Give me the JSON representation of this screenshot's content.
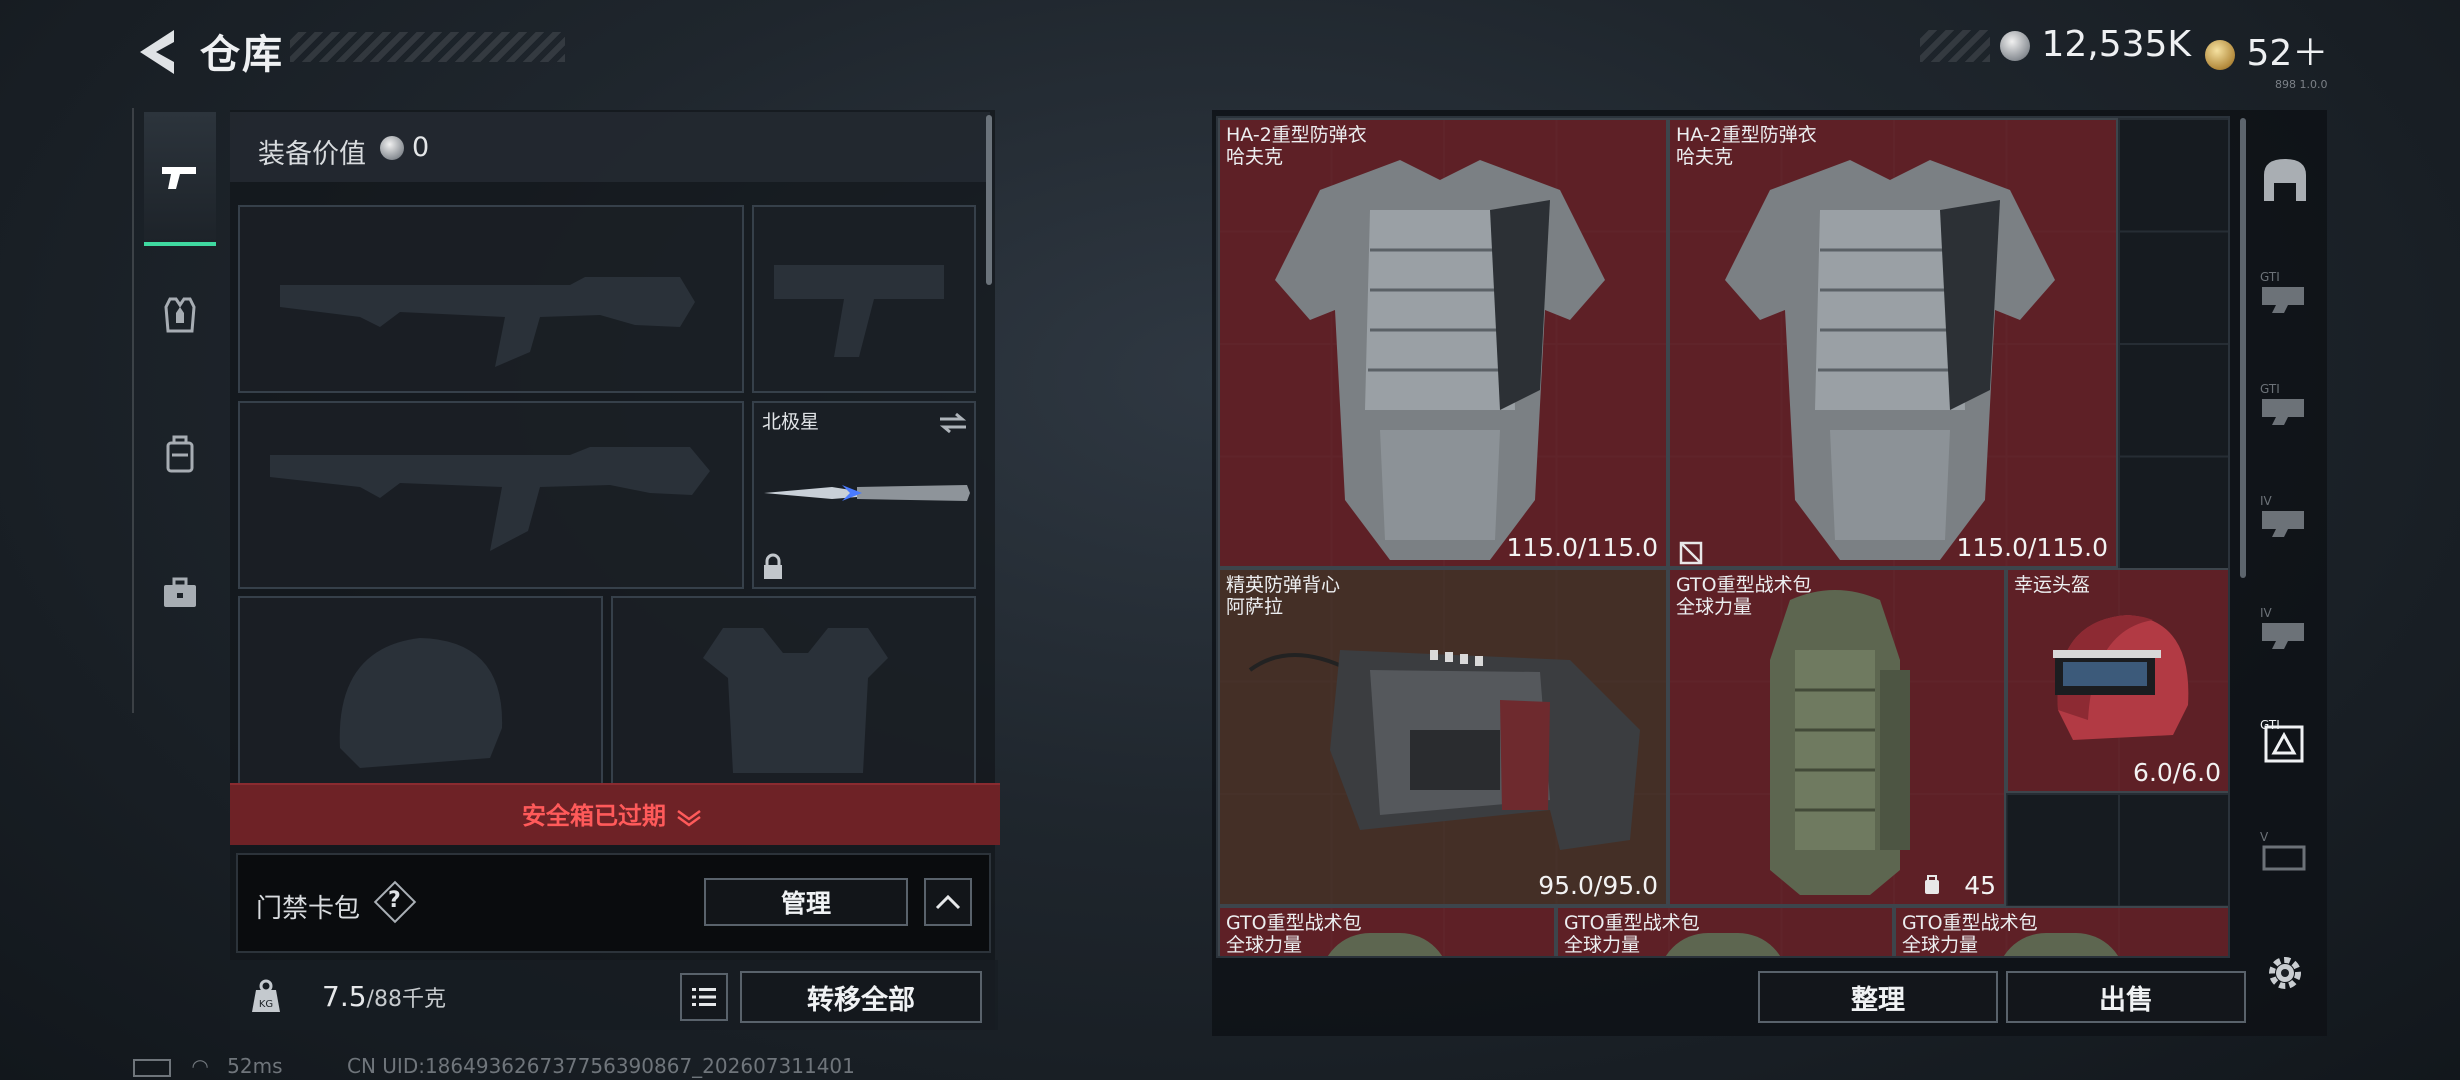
{
  "header": {
    "title": "仓库",
    "currency_silver": "12,535K",
    "currency_gold": "52＋",
    "version": "898 1.0.0"
  },
  "loadout": {
    "equip_value_label": "装备价值",
    "equip_value": "0",
    "melee_name": "北极星",
    "safebox_status": "安全箱已过期",
    "keycard_label": "门禁卡包",
    "help_mark": "?",
    "manage_button": "管理",
    "weight_current": "7.5",
    "weight_capacity": "/88千克",
    "weight_icon": "KG",
    "transfer_all_button": "转移全部"
  },
  "stash": {
    "items": [
      {
        "name": "HA-2重型防弹衣",
        "sub": "哈夫克",
        "durability": "115.0/115.0"
      },
      {
        "name": "HA-2重型防弹衣",
        "sub": "哈夫克",
        "durability": "115.0/115.0"
      },
      {
        "name": "精英防弹背心",
        "sub": "阿萨拉",
        "durability": "95.0/95.0"
      },
      {
        "name": "GTO重型战术包",
        "sub": "全球力量",
        "durability": "45"
      },
      {
        "name": "幸运头盔",
        "sub": "",
        "durability": "6.0/6.0"
      },
      {
        "name": "GTO重型战术包",
        "sub": "全球力量",
        "durability": ""
      },
      {
        "name": "GTO重型战术包",
        "sub": "全球力量",
        "durability": ""
      },
      {
        "name": "GTO重型战术包",
        "sub": "全球力量",
        "durability": ""
      }
    ],
    "sort_button": "整理",
    "sell_button": "出售",
    "side_tabs": [
      "GTI",
      "GTI",
      "IV",
      "IV",
      "GTI",
      "V"
    ]
  },
  "status_bar": {
    "ping": "52ms",
    "uid": "CN UID:186493626737756390867_202607311401"
  },
  "colors": {
    "accent": "#3fd9a0",
    "warning": "#ff5a5a",
    "item_red": "#6e2228"
  }
}
